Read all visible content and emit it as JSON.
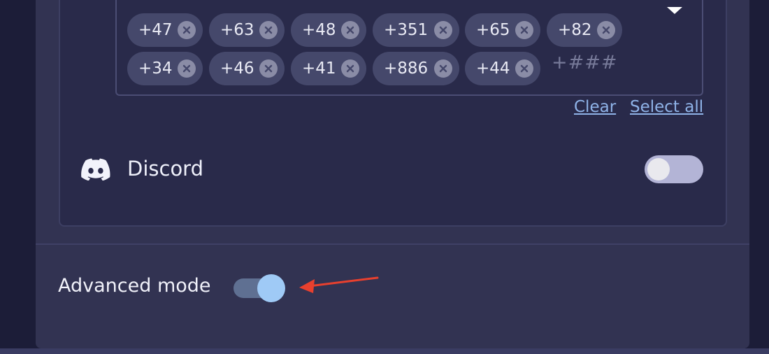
{
  "country_codes": {
    "chips_row1": [
      "+47",
      "+63",
      "+48",
      "+351",
      "+65",
      "+82"
    ],
    "chips_row2": [
      "+34",
      "+46",
      "+41",
      "+886",
      "+44"
    ],
    "input_placeholder": "+###"
  },
  "actions": {
    "clear_label": "Clear",
    "select_all_label": "Select all"
  },
  "discord": {
    "label": "Discord",
    "enabled": false
  },
  "advanced": {
    "label": "Advanced mode",
    "enabled": true
  },
  "colors": {
    "background": "#1c1d38",
    "panel": "#323352",
    "card": "#292a4a",
    "chip": "#45486b",
    "link": "#8fb3e8",
    "toggle_on_knob": "#9fcaf6",
    "annotation_arrow": "#e8402e"
  }
}
